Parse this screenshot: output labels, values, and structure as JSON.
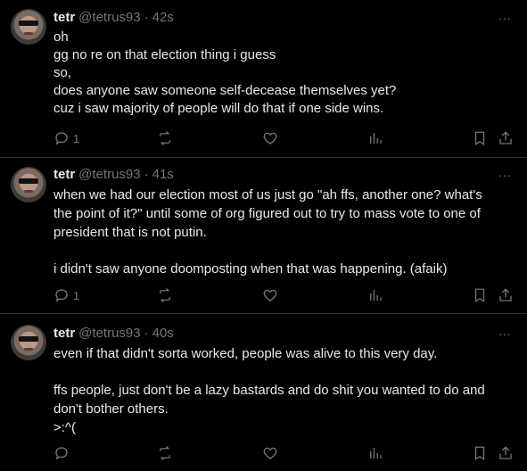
{
  "posts": [
    {
      "name": "tetr",
      "handle": "@tetrus93",
      "time": "42s",
      "lines": [
        "oh",
        "gg no re on that election thing i guess",
        "so,",
        "does anyone saw someone self-decease themselves yet?",
        "cuz i saw majority of people will do that if one side wins."
      ],
      "reply_count": "1"
    },
    {
      "name": "tetr",
      "handle": "@tetrus93",
      "time": "41s",
      "lines": [
        "when we had our election most of us just go \"ah ffs, another one? what's",
        "the point of it?\" until some of org figured out to try to mass vote to one of",
        "president that is not putin.",
        "",
        "i didn't saw anyone doomposting when that was happening. (afaik)"
      ],
      "reply_count": "1"
    },
    {
      "name": "tetr",
      "handle": "@tetrus93",
      "time": "40s",
      "lines": [
        "even if that didn't sorta worked, people was alive to this very day.",
        "",
        "ffs people, just don't be a lazy bastards and do shit you wanted to do and",
        "don't bother others.",
        ">:^("
      ],
      "reply_count": ""
    }
  ],
  "dot_separator": "·",
  "more_glyph": "···",
  "icons": [
    "reply-icon",
    "repost-icon",
    "like-icon",
    "views-icon",
    "bookmark-icon",
    "share-icon"
  ],
  "colors": {
    "background": "#000000",
    "text": "#e7e9ea",
    "muted": "#71767b",
    "divider": "#2f3336"
  }
}
